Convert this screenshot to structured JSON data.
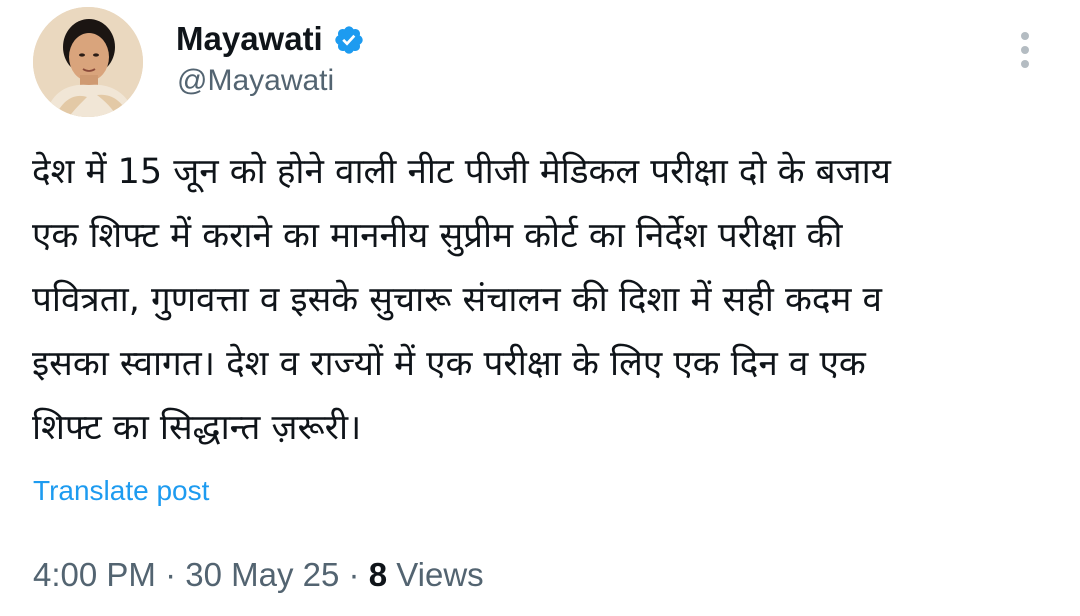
{
  "author": {
    "display_name": "Mayawati",
    "handle": "@Mayawati",
    "verified": true,
    "verified_color": "#1d9bf0"
  },
  "icons": {
    "avatar": "profile-photo",
    "verified": "verified-badge-icon",
    "more": "more-vertical-icon"
  },
  "tweet": {
    "lines": [
      "देश में 15 जून को होने वाली नीट पीजी मेडिकल परीक्षा दो के बजाय",
      "एक शिफ्ट में कराने का माननीय सुप्रीम कोर्ट का निर्देश परीक्षा की",
      "पवित्रता, गुणवत्ता व इसके सुचारू संचालन की दिशा में सही कदम व",
      "इसका स्वागत। देश व राज्यों में एक परीक्षा के लिए एक दिन व एक",
      "शिफ्ट का सिद्धान्त ज़रूरी।"
    ],
    "translate_label": "Translate post"
  },
  "meta": {
    "time": "4:00 PM",
    "separator": "·",
    "date": "30 May 25",
    "views_count": "8",
    "views_label": "Views"
  },
  "colors": {
    "text": "#0f1419",
    "secondary": "#536471",
    "link": "#1d9bf0"
  }
}
